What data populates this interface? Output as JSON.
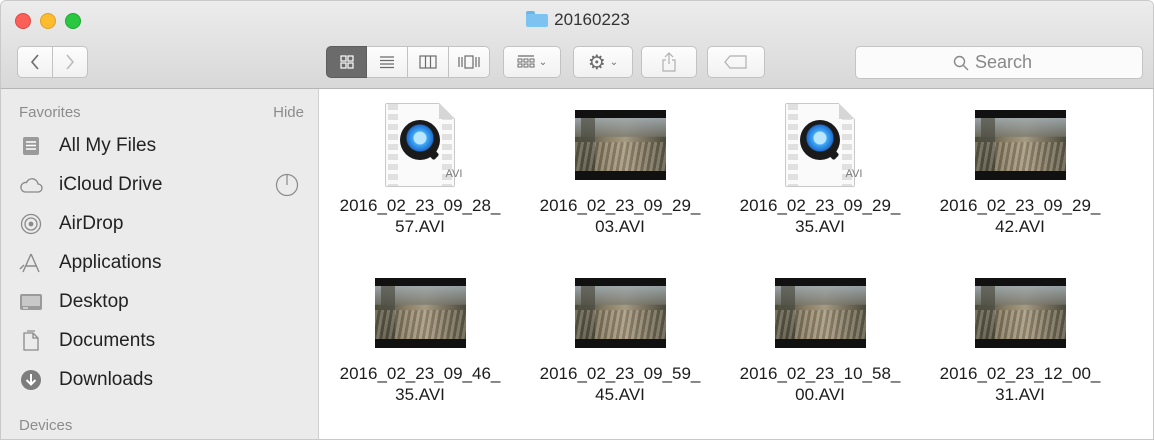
{
  "window": {
    "title": "20160223"
  },
  "toolbar": {
    "back_icon": "chevron-left-icon",
    "forward_icon": "chevron-right-icon",
    "view_modes": [
      "icon-view",
      "list-view",
      "column-view",
      "cover-flow-view"
    ],
    "active_view": "icon-view",
    "search_placeholder": "Search"
  },
  "sidebar": {
    "favorites_label": "Favorites",
    "hide_label": "Hide",
    "devices_label": "Devices",
    "items": [
      {
        "label": "All My Files",
        "icon": "all-files-icon"
      },
      {
        "label": "iCloud Drive",
        "icon": "cloud-icon"
      },
      {
        "label": "AirDrop",
        "icon": "airdrop-icon"
      },
      {
        "label": "Applications",
        "icon": "applications-icon"
      },
      {
        "label": "Desktop",
        "icon": "desktop-icon"
      },
      {
        "label": "Documents",
        "icon": "documents-icon"
      },
      {
        "label": "Downloads",
        "icon": "downloads-icon"
      }
    ]
  },
  "files": [
    {
      "name": "2016_02_23_09_28_\n57.AVI",
      "thumb": "avi-document",
      "badge": "AVI"
    },
    {
      "name": "2016_02_23_09_29_\n03.AVI",
      "thumb": "video-frame"
    },
    {
      "name": "2016_02_23_09_29_\n35.AVI",
      "thumb": "avi-document",
      "badge": "AVI"
    },
    {
      "name": "2016_02_23_09_29_\n42.AVI",
      "thumb": "video-frame"
    },
    {
      "name": "2016_02_23_09_46_\n35.AVI",
      "thumb": "video-frame"
    },
    {
      "name": "2016_02_23_09_59_\n45.AVI",
      "thumb": "video-frame"
    },
    {
      "name": "2016_02_23_10_58_\n00.AVI",
      "thumb": "video-frame"
    },
    {
      "name": "2016_02_23_12_00_\n31.AVI",
      "thumb": "video-frame"
    }
  ]
}
